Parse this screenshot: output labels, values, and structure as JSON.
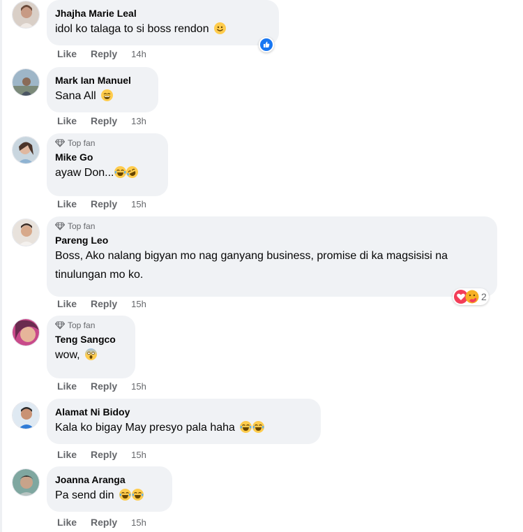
{
  "actions": {
    "like": "Like",
    "reply": "Reply"
  },
  "badge": {
    "top_fan": "Top fan",
    "icon": "diamond-icon"
  },
  "colors": {
    "bubble": "#f0f2f5",
    "meta": "#65676b",
    "like_blue": "#1877f2",
    "love_red": "#f33e58"
  },
  "comments": [
    {
      "name": "Jhajha Marie Leal",
      "text": "idol ko talaga to si boss rendon",
      "emojis": [
        "smile"
      ],
      "time": "14h",
      "top_fan": false,
      "reaction": "like"
    },
    {
      "name": "Mark Ian Manuel",
      "text": "Sana All",
      "emojis": [
        "grin"
      ],
      "time": "13h",
      "top_fan": false
    },
    {
      "name": "Mike Go",
      "text": "ayaw Don...",
      "emojis": [
        "joy",
        "rofl"
      ],
      "time": "15h",
      "top_fan": true
    },
    {
      "name": "Pareng Leo",
      "text": "Boss, Ako nalang bigyan mo nag ganyang business, promise di ka magsisisi na tinulungan mo ko.",
      "emojis": [],
      "time": "15h",
      "top_fan": true,
      "reactions": [
        "love",
        "care"
      ],
      "reaction_count": "2"
    },
    {
      "name": "Teng Sangco",
      "text": "wow,",
      "emojis": [
        "scream"
      ],
      "time": "15h",
      "top_fan": true
    },
    {
      "name": "Alamat Ni Bidoy",
      "text": "Kala ko bigay May presyo pala haha",
      "emojis": [
        "joy",
        "joy"
      ],
      "time": "15h",
      "top_fan": false
    },
    {
      "name": "Joanna Aranga",
      "text": "Pa send din",
      "emojis": [
        "joy",
        "joy"
      ],
      "time": "15h",
      "top_fan": false
    }
  ]
}
